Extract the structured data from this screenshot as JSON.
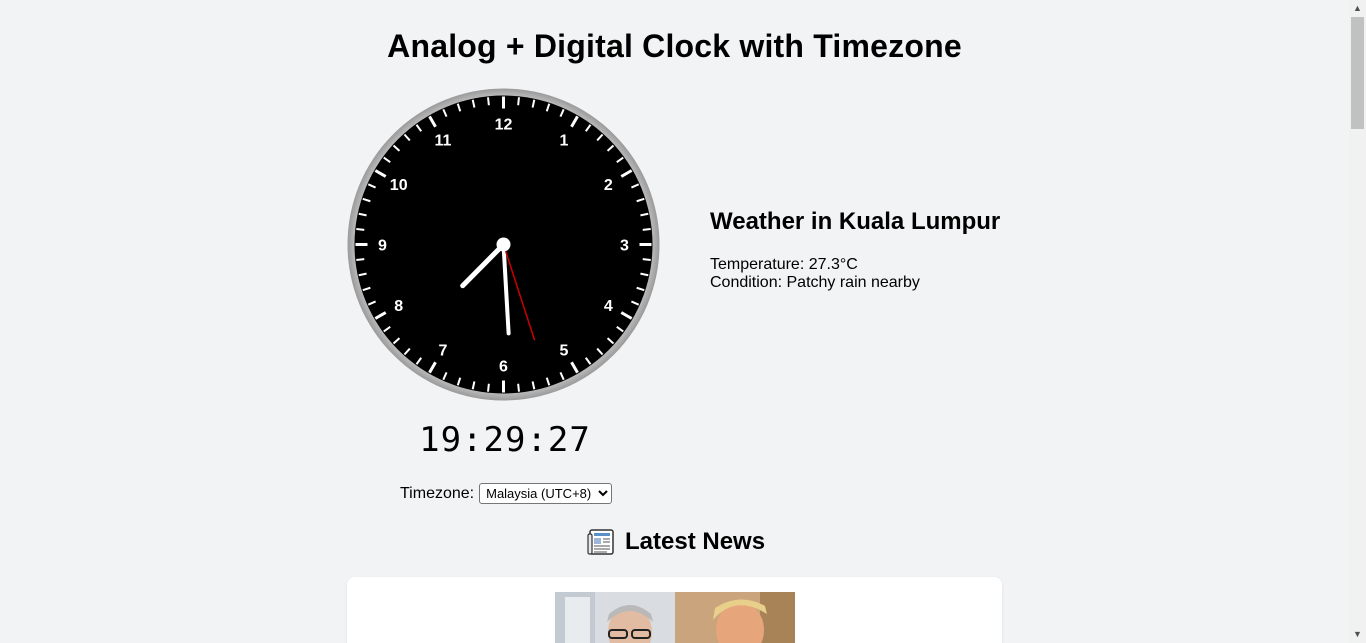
{
  "page": {
    "title": "Analog + Digital Clock with Timezone"
  },
  "clock": {
    "numerals": [
      "12",
      "1",
      "2",
      "3",
      "4",
      "5",
      "6",
      "7",
      "8",
      "9",
      "10",
      "11"
    ],
    "time": {
      "hours": 19,
      "minutes": 29,
      "seconds": 27
    },
    "digital_time": "19:29:27",
    "face_color": "#000000",
    "rim_color": "#c8c8c8",
    "hand_color": "#ffffff",
    "second_hand_color": "#cc0000"
  },
  "timezone": {
    "label": "Timezone:",
    "selected": "Malaysia (UTC+8)"
  },
  "weather": {
    "heading": "Weather in Kuala Lumpur",
    "temperature": "Temperature: 27.3°C",
    "condition": "Condition: Patchy rain nearby"
  },
  "news": {
    "icon": "newspaper-icon",
    "heading": "Latest News"
  }
}
